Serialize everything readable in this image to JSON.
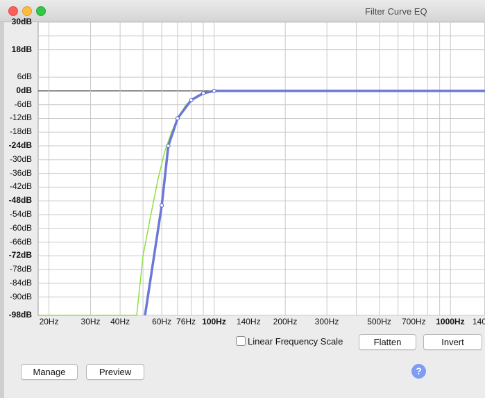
{
  "window": {
    "title": "Filter Curve EQ"
  },
  "db_labels": [
    "30dB",
    "18dB",
    "6dB",
    "0dB",
    "-6dB",
    "-12dB",
    "-18dB",
    "-24dB",
    "-30dB",
    "-36dB",
    "-42dB",
    "-48dB",
    "-54dB",
    "-60dB",
    "-66dB",
    "-72dB",
    "-78dB",
    "-84dB",
    "-90dB",
    "-98dB"
  ],
  "freq_labels": [
    "20Hz",
    "30Hz",
    "40Hz",
    "60Hz",
    "76Hz",
    "100Hz",
    "140Hz",
    "200Hz",
    "300Hz",
    "500Hz",
    "700Hz",
    "1000Hz",
    "140"
  ],
  "controls": {
    "linear_freq_label": "Linear Frequency Scale",
    "linear_freq_checked": false,
    "flatten": "Flatten",
    "invert": "Invert",
    "manage": "Manage",
    "preview": "Preview",
    "help": "?"
  },
  "colors": {
    "user_curve": "#6b78d6",
    "response_curve": "#8ee040",
    "grid": "#c8c8c8"
  },
  "chart_data": {
    "type": "line",
    "x_scale": "log",
    "xlim": [
      18,
      1400
    ],
    "ylim": [
      -98,
      30
    ],
    "grid": true,
    "series": [
      {
        "points": [
          [
            51,
            -98
          ],
          [
            60,
            -50
          ],
          [
            64,
            -24
          ],
          [
            70,
            -12
          ],
          [
            80,
            -4
          ],
          [
            90,
            -1
          ],
          [
            100,
            0
          ],
          [
            1400,
            0
          ]
        ]
      },
      {
        "points": [
          [
            18,
            -98
          ],
          [
            47,
            -98
          ],
          [
            50,
            -72
          ],
          [
            54,
            -54
          ],
          [
            58,
            -38
          ],
          [
            62,
            -26
          ],
          [
            66,
            -18
          ],
          [
            70,
            -12
          ],
          [
            76,
            -6
          ],
          [
            85,
            -2
          ],
          [
            100,
            0
          ],
          [
            1400,
            0
          ]
        ]
      }
    ],
    "control_points": [
      [
        60,
        -50
      ],
      [
        64,
        -24
      ],
      [
        70,
        -12
      ],
      [
        80,
        -4
      ],
      [
        90,
        -1
      ],
      [
        100,
        0
      ]
    ]
  }
}
